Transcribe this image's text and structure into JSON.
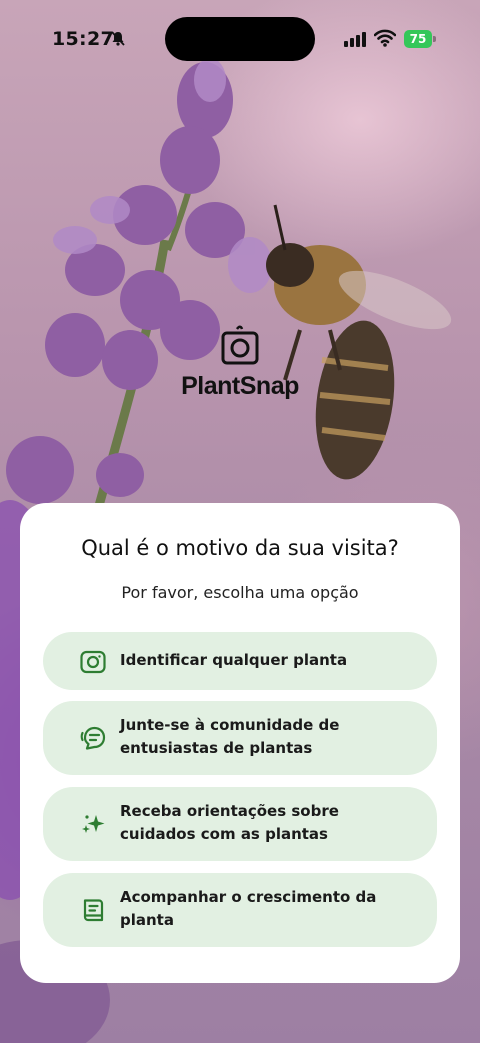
{
  "status_bar": {
    "time": "15:27",
    "battery": "75"
  },
  "app": {
    "name": "PlantSnap"
  },
  "onboarding": {
    "title": "Qual é o motivo da sua visita?",
    "subtitle": "Por favor, escolha uma opção",
    "options": [
      {
        "label": "Identificar qualquer planta",
        "icon": "camera-icon"
      },
      {
        "label": "Junte-se à comunidade de entusiastas de plantas",
        "icon": "chat-icon"
      },
      {
        "label": "Receba orientações sobre cuidados com as plantas",
        "icon": "sparkles-icon"
      },
      {
        "label": "Acompanhar o crescimento da planta",
        "icon": "journal-icon"
      }
    ]
  },
  "colors": {
    "option_bg": "#e2f0e2",
    "icon_green": "#2e7d32",
    "battery_green": "#34c759"
  }
}
